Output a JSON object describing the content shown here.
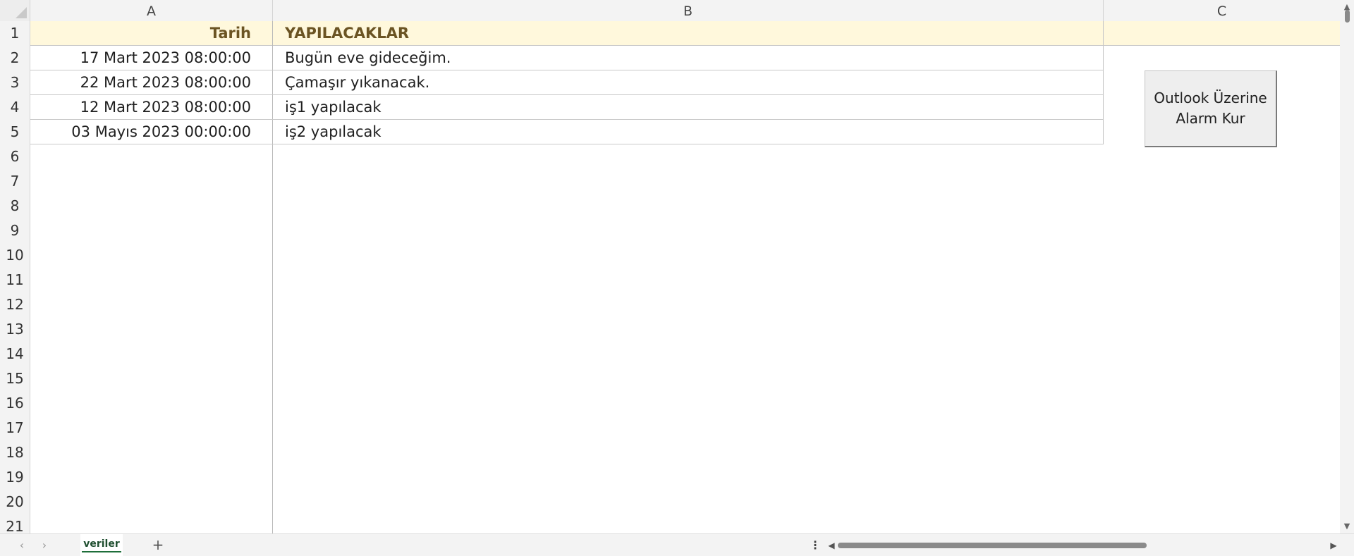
{
  "columns": [
    "A",
    "B",
    "C"
  ],
  "row_numbers": [
    "1",
    "2",
    "3",
    "4",
    "5",
    "6",
    "7",
    "8",
    "9",
    "10",
    "11",
    "12",
    "13",
    "14",
    "15",
    "16",
    "17",
    "18",
    "19",
    "20",
    "21"
  ],
  "table": {
    "headers": {
      "tarih": "Tarih",
      "yapilacaklar": "YAPILACAKLAR"
    },
    "rows": [
      {
        "tarih": "17 Mart 2023 08:00:00",
        "yapilacak": "Bugün eve gideceğim."
      },
      {
        "tarih": "22 Mart 2023 08:00:00",
        "yapilacak": "Çamaşır yıkanacak."
      },
      {
        "tarih": "12 Mart 2023 08:00:00",
        "yapilacak": "iş1 yapılacak"
      },
      {
        "tarih": "03 Mayıs 2023 00:00:00",
        "yapilacak": "iş2 yapılacak"
      }
    ]
  },
  "macro_button": {
    "label": "Outlook Üzerine\nAlarm Kur"
  },
  "sheet_tabs": [
    {
      "name": "veriler",
      "active": true
    }
  ],
  "icons": {
    "prev_sheet": "chevron-left-icon",
    "next_sheet": "chevron-right-icon",
    "add_sheet": "plus-icon",
    "more": "vertical-dots-icon"
  },
  "colors": {
    "header_row_fill": "#fff8dc",
    "header_text": "#6b5423",
    "active_tab_underline": "#1e6e3a"
  }
}
